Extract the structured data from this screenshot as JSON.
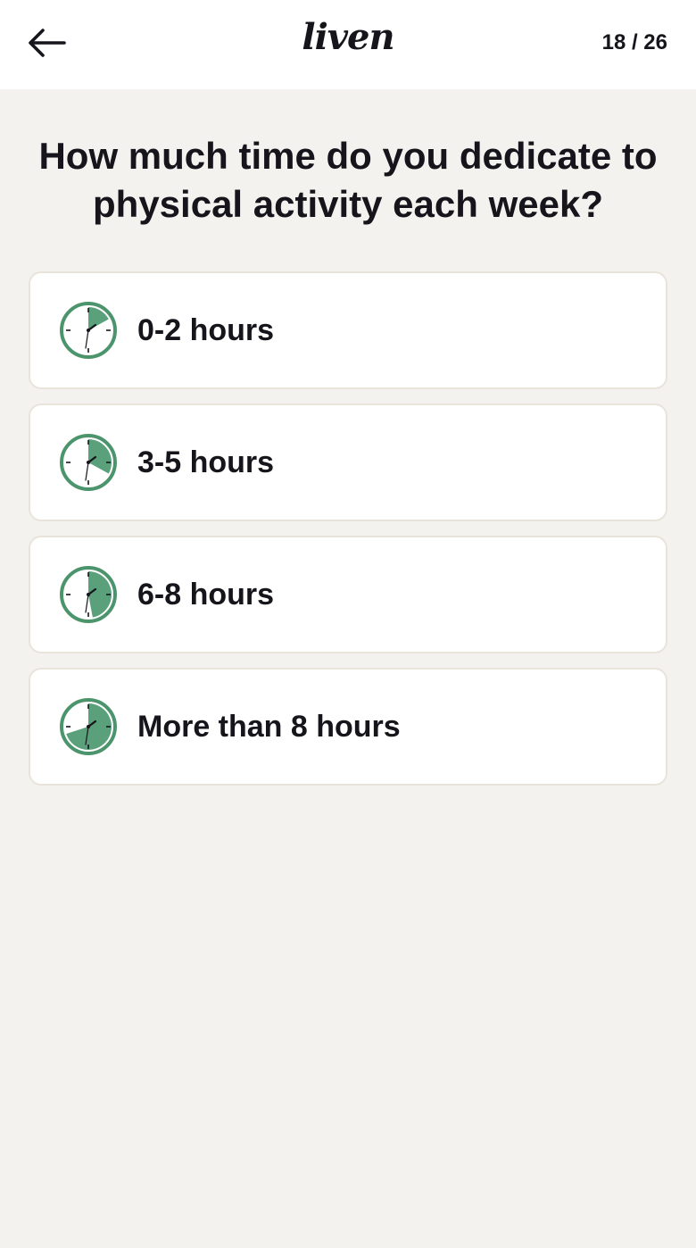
{
  "header": {
    "logo": "liven",
    "progress": "18 / 26"
  },
  "question": "How much time do you dedicate to physical activity each week?",
  "options": [
    {
      "label": "0-2 hours",
      "fill_fraction": 0.17
    },
    {
      "label": "3-5 hours",
      "fill_fraction": 0.33
    },
    {
      "label": "6-8 hours",
      "fill_fraction": 0.47
    },
    {
      "label": "More than 8 hours",
      "fill_fraction": 0.7
    }
  ],
  "colors": {
    "accent_green": "#5aa07a",
    "clock_border": "#4c946c",
    "background": "#f4f2ee",
    "card_border": "#e8e4da",
    "text": "#16151c"
  },
  "icons": {
    "back": "arrow-left-icon",
    "option": "clock-icon"
  }
}
